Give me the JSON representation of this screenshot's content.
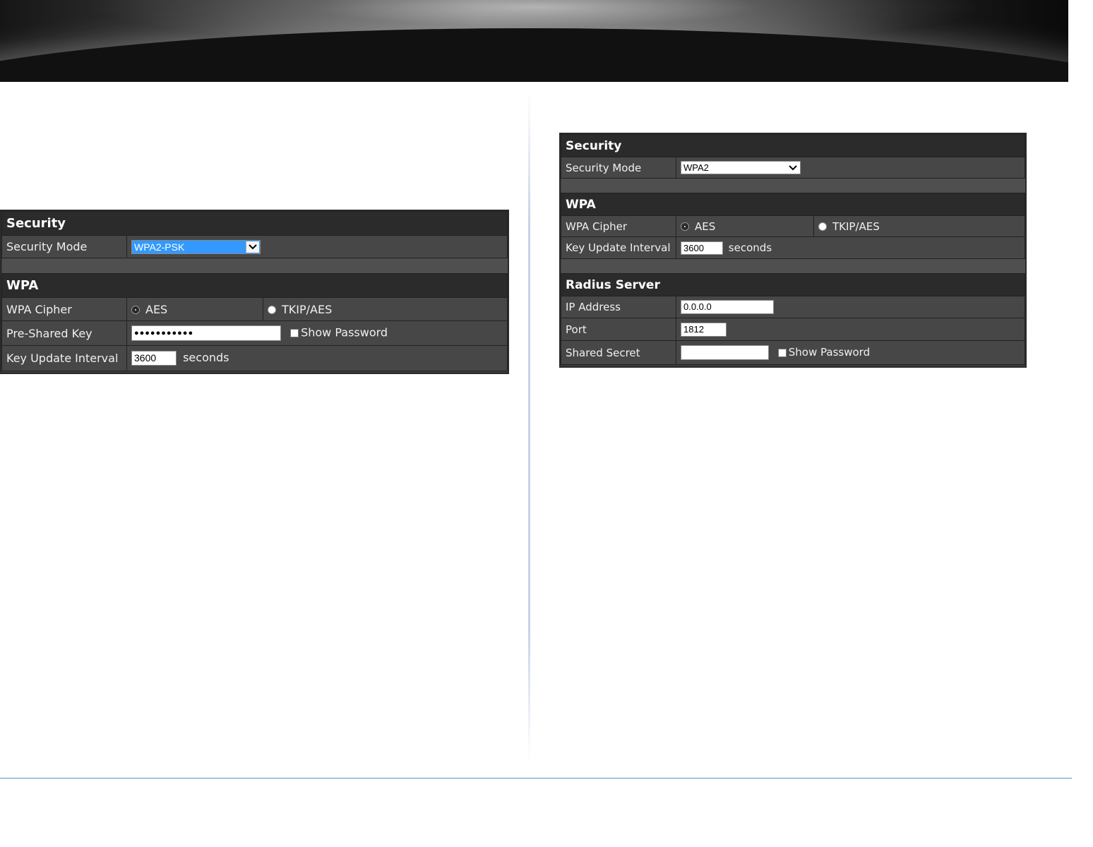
{
  "left": {
    "security": {
      "title": "Security",
      "mode_label": "Security Mode",
      "mode_value": "WPA2-PSK"
    },
    "wpa": {
      "title": "WPA",
      "cipher_label": "WPA Cipher",
      "cipher_options": [
        "AES",
        "TKIP/AES"
      ],
      "selected_cipher": "AES",
      "psk_label": "Pre-Shared Key",
      "psk_value": "●●●●●●●●●●●",
      "show_password_label": "Show Password",
      "interval_label": "Key Update Interval",
      "interval_value": "3600",
      "interval_unit": "seconds"
    }
  },
  "right": {
    "security": {
      "title": "Security",
      "mode_label": "Security Mode",
      "mode_value": "WPA2"
    },
    "wpa": {
      "title": "WPA",
      "cipher_label": "WPA Cipher",
      "cipher_options": [
        "AES",
        "TKIP/AES"
      ],
      "selected_cipher": "AES",
      "interval_label": "Key Update Interval",
      "interval_value": "3600",
      "interval_unit": "seconds"
    },
    "radius": {
      "title": "Radius Server",
      "ip_label": "IP Address",
      "ip_value": "0.0.0.0",
      "port_label": "Port",
      "port_value": "1812",
      "secret_label": "Shared Secret",
      "secret_value": "",
      "show_password_label": "Show Password"
    }
  },
  "icons": {
    "dropdown": "chevron-down-icon",
    "radio": "radio-icon",
    "checkbox": "checkbox-icon"
  },
  "colors": {
    "panel_bg": "#3c3c3c",
    "header_bg": "#2b2b2b",
    "footer_line": "#5b8fd0"
  }
}
